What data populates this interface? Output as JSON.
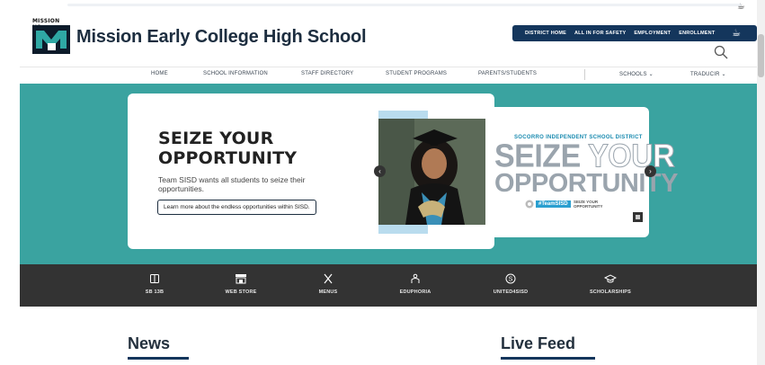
{
  "browser": {
    "coffee_icon": "coffee-icon"
  },
  "header": {
    "logo_text": "MISSION HS",
    "school_name": "Mission Early College High School",
    "utility_links": [
      "DISTRICT HOME",
      "ALL IN FOR SAFETY",
      "EMPLOYMENT",
      "ENROLLMENT"
    ],
    "utility_icon": "coffee-cup-icon",
    "search_icon": "search-icon",
    "colors": {
      "brand_navy": "#14365c",
      "title": "#1c2d3f"
    }
  },
  "nav": {
    "items": [
      "HOME",
      "SCHOOL INFORMATION",
      "STAFF DIRECTORY",
      "STUDENT PROGRAMS",
      "PARENTS/STUDENTS"
    ],
    "dropdowns": [
      "SCHOOLS",
      "TRADUCIR"
    ]
  },
  "hero": {
    "background": "#3aa3a0",
    "headline": "SEIZE YOUR OPPORTUNITY",
    "headline_line1": "SEIZE YOUR",
    "headline_line2": "OPPORTUNITY",
    "subtext": "Team SISD wants all students to seize their opportunities.",
    "cta_label": "Learn more about the endless opportunities within SISD.",
    "poster": {
      "district": "SOCORRO INDEPENDENT SCHOOL DISTRICT",
      "line1_a": "SEIZE",
      "line1_b": "YOUR",
      "line2": "OPPORTUNITY",
      "tag": "#TeamSISD",
      "mini_1": "SEIZE YOUR",
      "mini_2": "OPPORTUNITY"
    },
    "prev_icon": "chevron-left-icon",
    "next_icon": "chevron-right-icon"
  },
  "quick_links": [
    {
      "label": "SB 13B",
      "icon": "book-icon"
    },
    {
      "label": "WEB STORE",
      "icon": "store-icon"
    },
    {
      "label": "MENUS",
      "icon": "utensils-icon"
    },
    {
      "label": "EDUPHORIA",
      "icon": "graduation-person-icon"
    },
    {
      "label": "UNITED4SISD",
      "icon": "dollar-circle-icon"
    },
    {
      "label": "SCHOLARSHIPS",
      "icon": "mortarboard-icon"
    }
  ],
  "sections": {
    "news": "News",
    "live_feed": "Live Feed"
  }
}
